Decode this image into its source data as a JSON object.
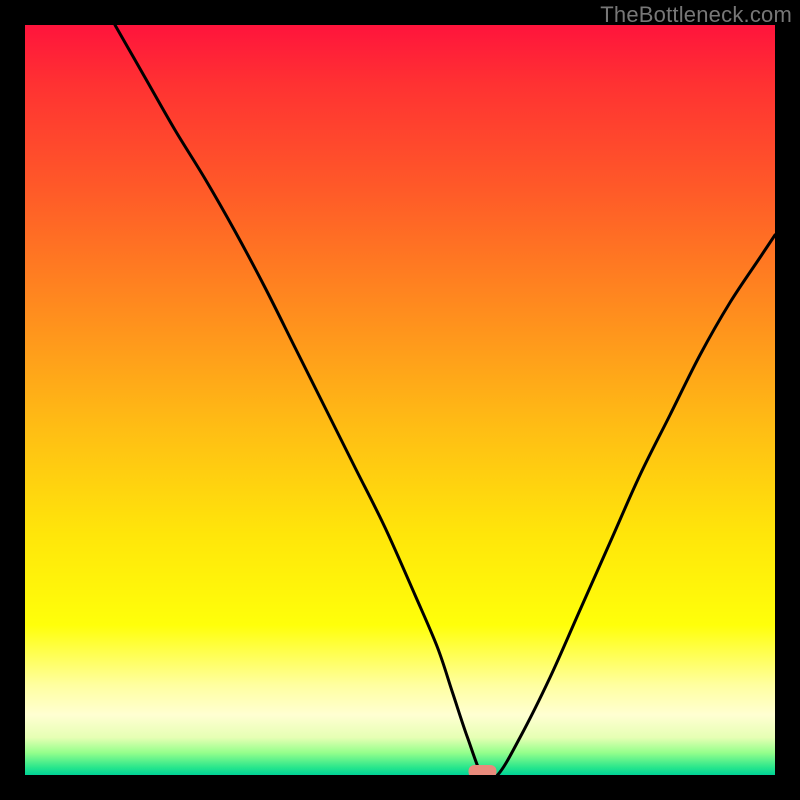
{
  "watermark": "TheBottleneck.com",
  "chart_data": {
    "type": "line",
    "title": "",
    "xlabel": "",
    "ylabel": "",
    "xlim": [
      0,
      100
    ],
    "ylim": [
      0,
      100
    ],
    "grid": false,
    "legend": false,
    "description": "Bottleneck percentage curve over a red-yellow-green vertical gradient. The black curve descends from the top-left, reaches a flat minimum near x≈61, then rises toward the right. A small salmon-colored marker sits at the minimum on the green band.",
    "marker": {
      "x": 61,
      "y": 0,
      "color": "#e98b7c"
    },
    "series": [
      {
        "name": "bottleneck-curve",
        "x": [
          12,
          16,
          20,
          24,
          28,
          32,
          36,
          40,
          44,
          48,
          52,
          55,
          57,
          59,
          61,
          63,
          66,
          70,
          74,
          78,
          82,
          86,
          90,
          94,
          98,
          100
        ],
        "y": [
          100,
          93,
          86,
          79.5,
          72.5,
          65,
          57,
          49,
          41,
          33,
          24,
          17,
          11,
          5,
          0,
          0,
          5,
          13,
          22,
          31,
          40,
          48,
          56,
          63,
          69,
          72
        ]
      }
    ],
    "background_gradient": {
      "direction": "top-to-bottom",
      "stops": [
        {
          "pos": 0.0,
          "color": "#ff143c"
        },
        {
          "pos": 0.08,
          "color": "#ff3232"
        },
        {
          "pos": 0.22,
          "color": "#ff5a28"
        },
        {
          "pos": 0.38,
          "color": "#ff8c1e"
        },
        {
          "pos": 0.54,
          "color": "#ffbe14"
        },
        {
          "pos": 0.68,
          "color": "#ffe60a"
        },
        {
          "pos": 0.8,
          "color": "#ffff0a"
        },
        {
          "pos": 0.88,
          "color": "#ffffa0"
        },
        {
          "pos": 0.92,
          "color": "#ffffd2"
        },
        {
          "pos": 0.95,
          "color": "#e6ffb4"
        },
        {
          "pos": 0.97,
          "color": "#96ff8c"
        },
        {
          "pos": 0.99,
          "color": "#28e68c"
        },
        {
          "pos": 1.0,
          "color": "#00d296"
        }
      ]
    }
  }
}
